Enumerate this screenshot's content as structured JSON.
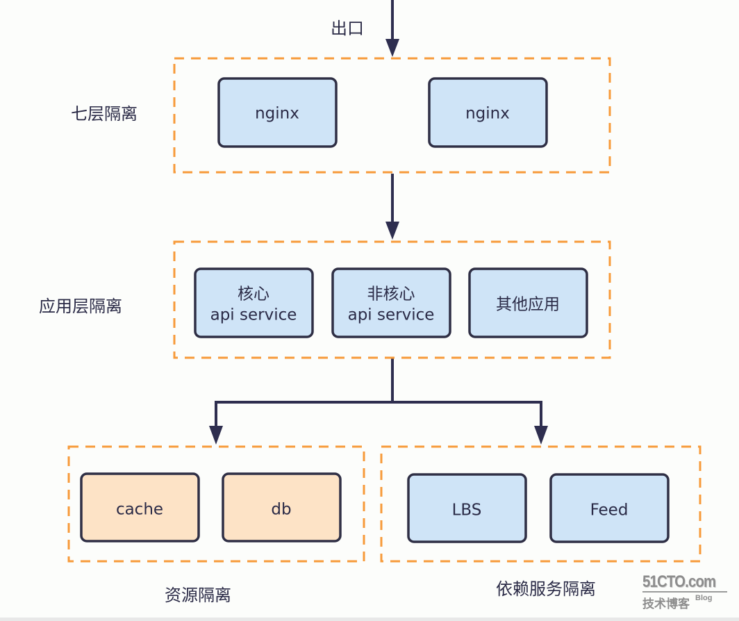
{
  "diagram": {
    "entry_label": "出口",
    "groups": [
      {
        "id": "l7",
        "label": "七层隔离",
        "nodes": [
          {
            "lines": [
              "nginx"
            ],
            "style": "blue"
          },
          {
            "lines": [
              "nginx"
            ],
            "style": "blue"
          }
        ]
      },
      {
        "id": "app",
        "label": "应用层隔离",
        "nodes": [
          {
            "lines": [
              "核心",
              "api service"
            ],
            "style": "blue"
          },
          {
            "lines": [
              "非核心",
              "api service"
            ],
            "style": "blue"
          },
          {
            "lines": [
              "其他应用"
            ],
            "style": "blue"
          }
        ]
      },
      {
        "id": "resource",
        "label": "资源隔离",
        "nodes": [
          {
            "lines": [
              "cache"
            ],
            "style": "orange"
          },
          {
            "lines": [
              "db"
            ],
            "style": "orange"
          }
        ]
      },
      {
        "id": "dependency",
        "label": "依赖服务隔离",
        "nodes": [
          {
            "lines": [
              "LBS"
            ],
            "style": "blue"
          },
          {
            "lines": [
              "Feed"
            ],
            "style": "blue"
          }
        ]
      }
    ],
    "edges": [
      {
        "from": "entry",
        "to": "l7"
      },
      {
        "from": "l7",
        "to": "app"
      },
      {
        "from": "app",
        "to": "resource"
      },
      {
        "from": "app",
        "to": "dependency"
      }
    ],
    "colors": {
      "frame": "#f79a3a",
      "node_blue": "#cfe4f7",
      "node_orange": "#fde3c6",
      "stroke": "#2f2f45",
      "text": "#2a2a46"
    }
  },
  "watermark": {
    "brand": "51CTO.com",
    "subtitle": "技术博客",
    "tag": "Blog"
  }
}
